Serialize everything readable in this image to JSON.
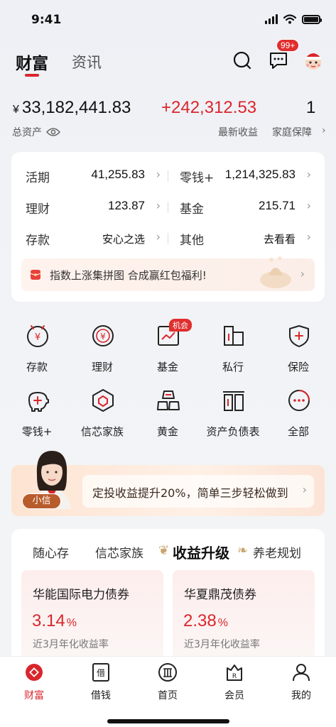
{
  "status_bar": {
    "time": "9:41"
  },
  "top_nav": {
    "tabs": [
      {
        "label": "财富"
      },
      {
        "label": "资讯"
      }
    ],
    "message_badge": "99+"
  },
  "summary": {
    "total_symbol": "¥",
    "total_amount": "33,182,441.83",
    "total_label": "总资产",
    "gain_amount": "+242,312.53",
    "gain_label": "最新收益",
    "family_count": "1",
    "family_label": "家庭保障"
  },
  "accounts": {
    "items": [
      {
        "name": "活期",
        "value": "41,255.83"
      },
      {
        "name": "零钱+",
        "value": "1,214,325.83"
      },
      {
        "name": "理财",
        "value": "123.87"
      },
      {
        "name": "基金",
        "value": "215.71"
      },
      {
        "name": "存款",
        "value": "安心之选"
      },
      {
        "name": "其他",
        "value": "去看看"
      }
    ],
    "promo_text": "指数上涨集拼图 合成赢红包福利!"
  },
  "services": {
    "items": [
      {
        "label": "存款",
        "icon": "deposit-icon"
      },
      {
        "label": "理财",
        "icon": "wealth-icon"
      },
      {
        "label": "基金",
        "icon": "fund-icon"
      },
      {
        "label": "私行",
        "icon": "private-bank-icon"
      },
      {
        "label": "保险",
        "icon": "insurance-icon"
      },
      {
        "label": "零钱+",
        "icon": "piggy-bank-icon"
      },
      {
        "label": "信芯家族",
        "icon": "family-icon"
      },
      {
        "label": "黄金",
        "icon": "gold-icon"
      },
      {
        "label": "资产负债表",
        "icon": "balance-sheet-icon"
      },
      {
        "label": "全部",
        "icon": "more-icon"
      }
    ],
    "fund_tag": "机会"
  },
  "assistant": {
    "name": "小信",
    "message": "定投收益提升20%，简单三步轻松做到"
  },
  "products": {
    "tabs": [
      {
        "label": "随心存"
      },
      {
        "label": "信芯家族"
      },
      {
        "label": "收益升级"
      },
      {
        "label": "养老规划"
      }
    ],
    "items": [
      {
        "name": "华能国际电力债券",
        "rate": "3.14",
        "unit": "%",
        "desc": "近3月年化收益率"
      },
      {
        "name": "华夏鼎茂债券",
        "rate": "2.38",
        "unit": "%",
        "desc": "近3月年化收益率"
      }
    ]
  },
  "tab_bar": {
    "items": [
      {
        "label": "财富"
      },
      {
        "label": "借钱"
      },
      {
        "label": "首页"
      },
      {
        "label": "会员"
      },
      {
        "label": "我的"
      }
    ]
  },
  "colors": {
    "accent": "#d9262c",
    "gold": "#c9a46a"
  }
}
